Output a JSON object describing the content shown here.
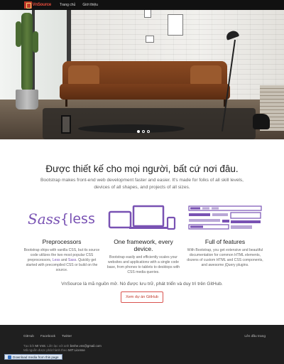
{
  "navbar": {
    "logo_text": "VnSource",
    "links": [
      "Trang chủ",
      "Giới thiệu"
    ]
  },
  "hero": {
    "slide_count": 3,
    "active_slide": 1
  },
  "marketing": {
    "heading": "Được thiết kế cho mọi người, bất cứ nơi đâu.",
    "lead_line1": "Bootstrap makes front-end web development faster and easier. It's made for folks of all skill levels,",
    "lead_line2": "devices of all shapes, and projects of all sizes."
  },
  "features": [
    {
      "title": "Preprocessors",
      "icon": "sass-less-logo",
      "text_before": "Bootstrap ships with vanilla CSS, but its source code utilizes the two most popular CSS preprocessors, ",
      "link1": "Less",
      "mid": " and ",
      "link2": "Sass",
      "text_after": ". Quickly get started with precompiled CSS or build on the source."
    },
    {
      "title": "One framework, every device.",
      "icon": "devices-icon",
      "text": "Bootstrap easily and efficiently scales your websites and applications with a single code base, from phones to tablets to desktops with CSS media queries."
    },
    {
      "title": "Full of features",
      "icon": "components-icon",
      "text": "With Bootstrap, you get extensive and beautiful documentation for common HTML elements, dozens of custom HTML and CSS components, and awesome jQuery plugins."
    }
  ],
  "opensource": {
    "text": "VnSource là mã nguồn mở. Nó được lưu trữ, phát triển và duy trì trên GitHub.",
    "button": "Xem dự án GitHub"
  },
  "footer": {
    "links": [
      "GitHub",
      "Facebook",
      "Twitter"
    ],
    "back_to_top": "Lên đầu trang",
    "note_line1_pre": "Tạo bởi ",
    "author": "Mr VnS",
    "note_line1_mid": ". Liên lạc với anh ",
    "email": "lienhe.vns@gmail.com",
    "note_line2_pre": "Mã nguồn được phát hành theo ",
    "license": "MIT License",
    "download_bar": "Download media from this page"
  },
  "colors": {
    "accent": "#7952b3",
    "brand_red": "#c0392b",
    "footer_bg": "#1f1f1f"
  }
}
